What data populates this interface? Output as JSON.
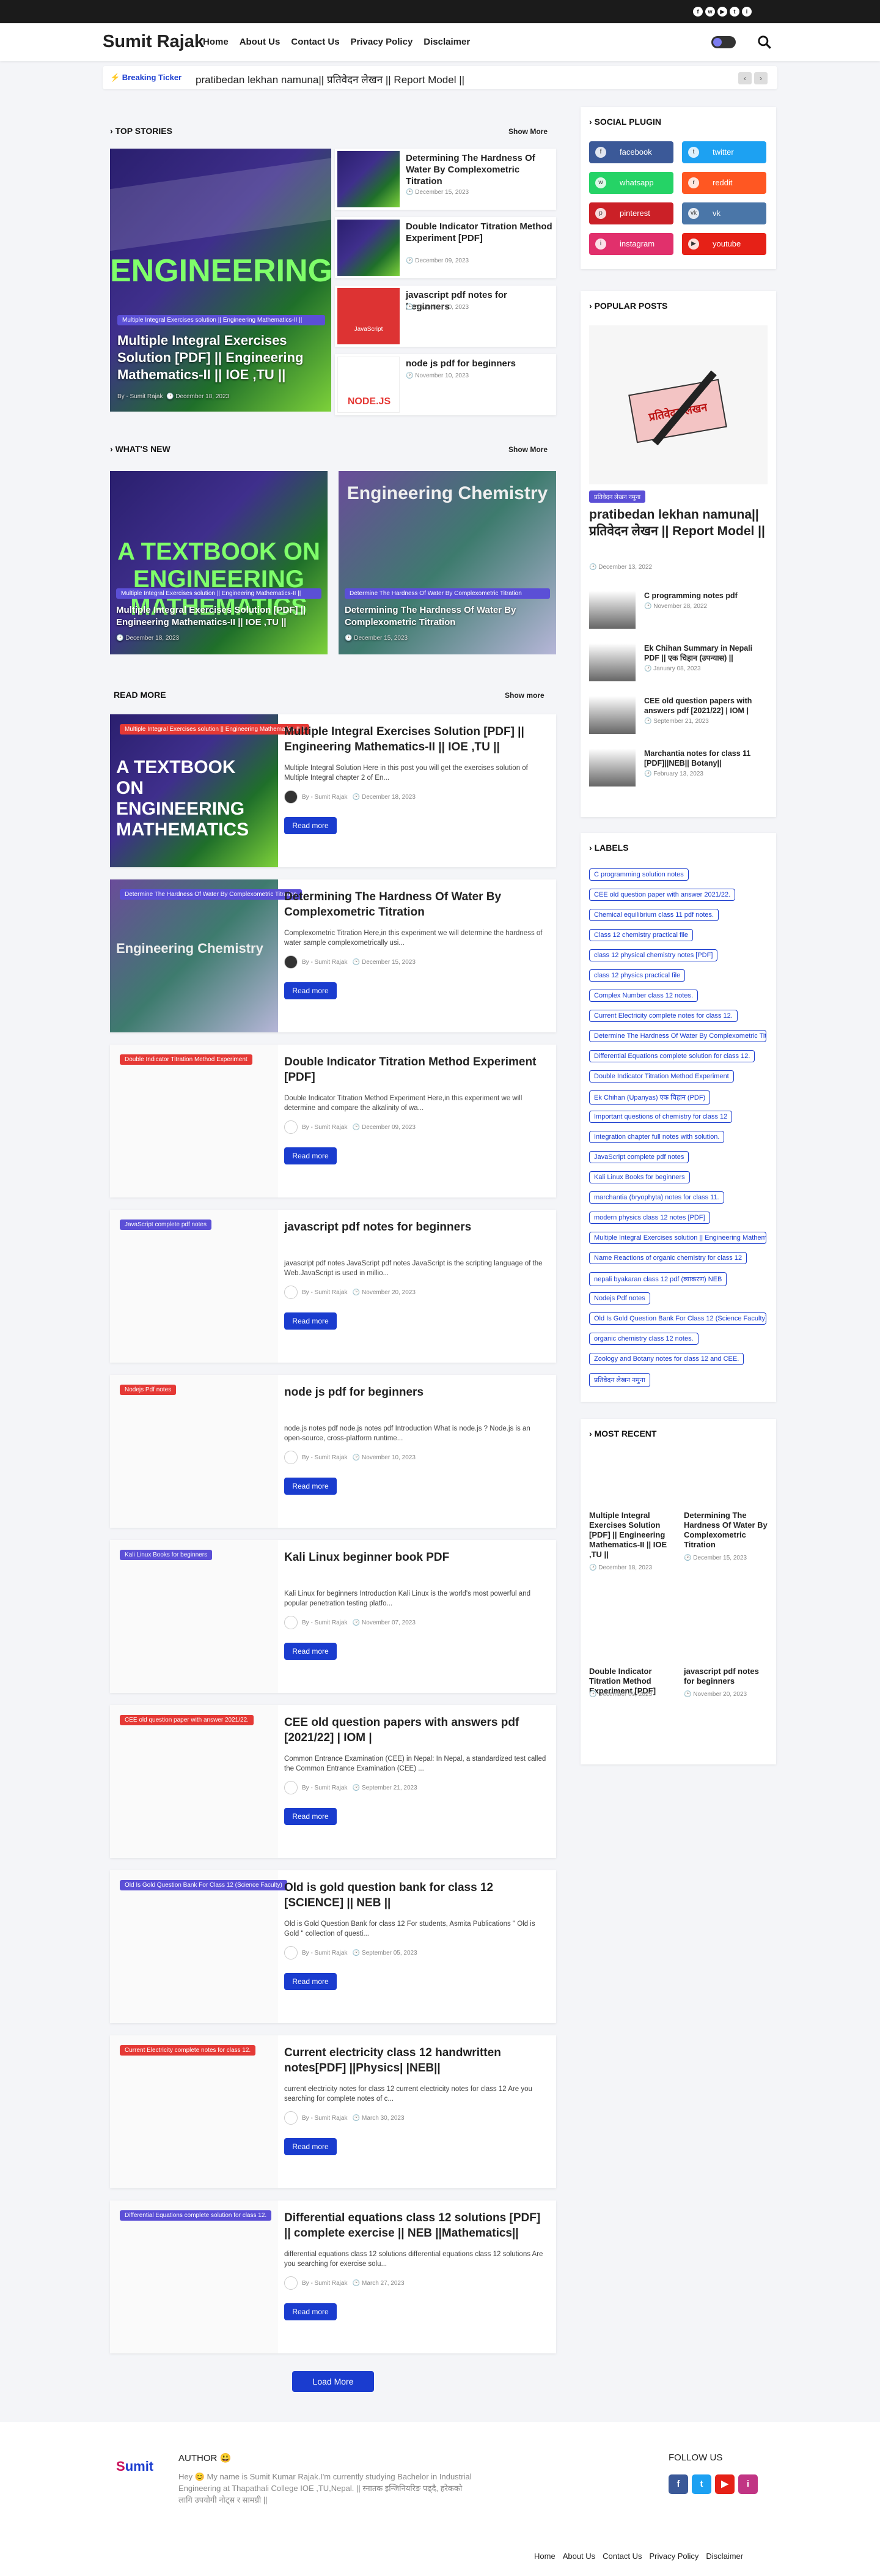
{
  "topbar": {
    "icons": [
      "facebook-icon",
      "whatsapp-icon",
      "youtube-icon",
      "twitter-icon",
      "instagram-icon"
    ]
  },
  "header": {
    "logo": "Sumit Rajak",
    "nav": [
      "Home",
      "About Us",
      "Contact Us",
      "Privacy Policy",
      "Disclaimer"
    ]
  },
  "ticker": {
    "label": "⚡ Breaking Ticker",
    "text": "pratibedan lekhan namuna|| प्रतिवेदन लेखन || Report Model ||"
  },
  "top_stories": {
    "title": "TOP STORIES",
    "show_more": "Show More",
    "feature": {
      "tag": "Multiple Integral Exercises solution || Engineering Mathematics-II ||",
      "title": "Multiple Integral Exercises Solution [PDF] || Engineering Mathematics-II || IOE ,TU ||",
      "author": "By - Sumit Rajak",
      "date": "December 18, 2023"
    },
    "items": [
      {
        "title": "Determining The Hardness Of Water By Complexometric Titration",
        "date": "December 15, 2023"
      },
      {
        "title": "Double Indicator Titration Method Experiment [PDF]",
        "date": "December 09, 2023"
      },
      {
        "title": "javascript pdf notes for beginners",
        "date": "November 20, 2023"
      },
      {
        "title": "node js pdf for beginners",
        "date": "November 10, 2023"
      }
    ]
  },
  "whats_new": {
    "title": "WHAT'S NEW",
    "show_more": "Show More",
    "items": [
      {
        "tag": "Multiple Integral Exercises solution || Engineering Mathematics-II ||",
        "title": "Multiple Integral Exercises Solution [PDF] || Engineering Mathematics-II || IOE ,TU ||",
        "date": "December 18, 2023"
      },
      {
        "tag": "Determine The Hardness Of Water By Complexometric Titration",
        "title": "Determining The Hardness Of Water By Complexometric Titration",
        "date": "December 15, 2023"
      }
    ]
  },
  "read_more": {
    "title": "READ MORE",
    "show_more": "Show more",
    "button": "Read more",
    "author": "By - Sumit Rajak",
    "posts": [
      {
        "tag": "Multiple Integral Exercises solution || Engineering Mathematics-II ||",
        "tag_color": "#e53935",
        "thumb": "math",
        "title": "Multiple Integral Exercises Solution [PDF] || Engineering Mathematics-II || IOE ,TU ||",
        "excerpt": "Multiple Integral Solution  Here in this post you will get the exercises solution of Multiple Integral chapter 2 of En...",
        "date": "December 18, 2023"
      },
      {
        "tag": "Determine The Hardness Of Water By Complexometric Titration",
        "tag_color": "#5b4fd6",
        "thumb": "chem",
        "title": "Determining The Hardness Of Water By Complexometric Titration",
        "excerpt": "Complexometric Titration  Here,in this experiment we will determine the hardness of water sample complexometrically usi...",
        "date": "December 15, 2023"
      },
      {
        "tag": "Double Indicator Titration Method Experiment",
        "tag_color": "#e53935",
        "thumb": "blank",
        "title": "Double Indicator Titration Method Experiment [PDF]",
        "excerpt": "Double Indicator Titration Method Experiment Here,in this experiment we will determine and compare the alkalinity of wa...",
        "date": "December 09, 2023"
      },
      {
        "tag": "JavaScript complete pdf notes",
        "tag_color": "#5b4fd6",
        "thumb": "blank",
        "title": "javascript pdf notes for beginners",
        "excerpt": "javascript pdf notes JavaScript pdf notes  JavaScript is the scripting language of the Web.JavaScript is used in millio...",
        "date": "November 20, 2023"
      },
      {
        "tag": "Nodejs Pdf notes",
        "tag_color": "#e53935",
        "thumb": "blank",
        "title": "node js pdf for beginners",
        "excerpt": "node.js notes pdf node.js notes pdf Introduction   What is node.js ? Node.js is an open-source, cross-platform runtime...",
        "date": "November 10, 2023"
      },
      {
        "tag": "Kali Linux Books for beginners",
        "tag_color": "#5b4fd6",
        "thumb": "blank",
        "title": "Kali Linux beginner book PDF",
        "excerpt": "Kali Linux for beginners  Introduction   Kali Linux is the world's most powerful and popular penetration testing platfo...",
        "date": "November 07, 2023"
      },
      {
        "tag": "CEE old question paper with answer 2021/22.",
        "tag_color": "#e53935",
        "thumb": "blank",
        "title": "CEE old question papers with answers pdf [2021/22] | IOM |",
        "excerpt": "Common Entrance Examination (CEE) in Nepal:  In Nepal, a standardized test called the Common Entrance Examination (CEE) ...",
        "date": "September 21, 2023"
      },
      {
        "tag": "Old Is Gold Question Bank For Class 12 (Science Faculty)",
        "tag_color": "#5b4fd6",
        "thumb": "blank",
        "title": "Old is gold question bank for class 12 [SCIENCE] || NEB ||",
        "excerpt": "Old is Gold Question Bank for class 12 For students, Asmita Publications \" Old is Gold \" collection of questi...",
        "date": "September 05, 2023"
      },
      {
        "tag": "Current Electricity complete notes for class 12.",
        "tag_color": "#e53935",
        "thumb": "blank",
        "title": "Current electricity class 12 handwritten notes[PDF] ||Physics| |NEB||",
        "excerpt": "current electricity notes for class 12 current electricity notes for class 12 Are you searching for complete notes of c...",
        "date": "March 30, 2023"
      },
      {
        "tag": "Differential Equations complete solution for class 12.",
        "tag_color": "#5b4fd6",
        "thumb": "blank",
        "title": "Differential equations class 12 solutions [PDF] || complete exercise || NEB ||Mathematics||",
        "excerpt": "differential equations class 12 solutions differential equations class 12 solutions Are you searching for exercise solu...",
        "date": "March 27, 2023"
      }
    ],
    "load_more": "Load More"
  },
  "sidebar": {
    "social": {
      "title": "SOCIAL PLUGIN",
      "buttons": [
        {
          "label": "facebook",
          "color": "#3b5998",
          "icon": "facebook-icon",
          "glyph": "f"
        },
        {
          "label": "twitter",
          "color": "#1da1f2",
          "icon": "twitter-icon",
          "glyph": "t"
        },
        {
          "label": "whatsapp",
          "color": "#25d366",
          "icon": "whatsapp-icon",
          "glyph": "w"
        },
        {
          "label": "reddit",
          "color": "#ff5722",
          "icon": "reddit-icon",
          "glyph": "r"
        },
        {
          "label": "pinterest",
          "color": "#cb2027",
          "icon": "pinterest-icon",
          "glyph": "p"
        },
        {
          "label": "vk",
          "color": "#4a76a8",
          "icon": "vk-icon",
          "glyph": "vk"
        },
        {
          "label": "instagram",
          "color": "#e1306c",
          "icon": "instagram-icon",
          "glyph": "i"
        },
        {
          "label": "youtube",
          "color": "#e62117",
          "icon": "youtube-icon",
          "glyph": "▶"
        }
      ]
    },
    "popular": {
      "title": "POPULAR POSTS",
      "main_tag": "प्रतिवेदन लेखन नमुना",
      "main_title": "pratibedan lekhan namuna|| प्रतिवेदन लेखन || Report Model ||",
      "main_date": "December 13, 2022",
      "main_art": "प्रतिवेदन लेखन",
      "items": [
        {
          "title": "C programming notes pdf",
          "date": "November 28, 2022"
        },
        {
          "title": "Ek Chihan Summary in Nepali PDF || एक चिहान (उपन्यास) ||",
          "date": "January 08, 2023"
        },
        {
          "title": "CEE old question papers with answers pdf [2021/22] | IOM |",
          "date": "September 21, 2023"
        },
        {
          "title": "Marchantia notes for class 11 [PDF]||NEB|| Botany||",
          "date": "February 13, 2023"
        }
      ]
    },
    "labels": {
      "title": "LABELS",
      "items": [
        "C programming solution notes",
        "CEE old question paper with answer 2021/22.",
        "Chemical equilibrium class 11 pdf notes.",
        "Class 12 chemistry practical file",
        "class 12 physical chemistry notes [PDF]",
        "class 12 physics practical file",
        "Complex Number class 12 notes.",
        "Current Electricity complete notes for class 12.",
        "Determine The Hardness Of Water By Complexometric Titration",
        "Differential Equations complete solution for class 12.",
        "Double Indicator Titration Method Experiment",
        "Ek Chihan (Upanyas) एक चिहान (PDF)",
        "Important questions of chemistry for class 12",
        "Integration chapter full notes with solution.",
        "JavaScript complete pdf notes",
        "Kali Linux Books for beginners",
        "marchantia (bryophyta) notes for class 11.",
        "modern physics class 12 notes [PDF]",
        "Multiple Integral Exercises solution || Engineering Mathematics-II ||",
        "Name Reactions of organic chemistry for class 12",
        "nepali byakaran class 12 pdf (व्याकरण) NEB",
        "Nodejs Pdf notes",
        "Old Is Gold Question Bank For Class 12 (Science Faculty)",
        "organic chemistry class 12 notes.",
        "Zoology and Botany notes for class 12 and CEE.",
        "प्रतिवेदन लेखन नमुना"
      ]
    },
    "recent": {
      "title": "MOST RECENT",
      "items": [
        {
          "title": "Multiple Integral Exercises Solution [PDF] || Engineering Mathematics-II || IOE ,TU ||",
          "date": "December 18, 2023"
        },
        {
          "title": "Determining The Hardness Of Water By Complexometric Titration",
          "date": "December 15, 2023"
        },
        {
          "title": "Double Indicator Titration Method Experiment [PDF]",
          "date": "December 09, 2023"
        },
        {
          "title": "javascript pdf notes for beginners",
          "date": "November 20, 2023"
        }
      ]
    }
  },
  "footer": {
    "author_title": "AUTHOR 😃",
    "author_text": "Hey 😊 My name is Sumit Kumar Rajak.I'm currently studying Bachelor in Industrial Engineering at Thapathali College IOE ,TU,Nepal. || स्नातक इन्जिनियरिङ पढ्दै, हरेकको लागि उपयोगी नोट्स र सामग्री ||",
    "follow_title": "FOLLOW US",
    "nav": [
      "Home",
      "About Us",
      "Contact Us",
      "Privacy Policy",
      "Disclaimer"
    ],
    "follow": [
      {
        "icon": "facebook-icon",
        "glyph": "f",
        "color": "#3b5998"
      },
      {
        "icon": "twitter-icon",
        "glyph": "t",
        "color": "#1da1f2"
      },
      {
        "icon": "youtube-icon",
        "glyph": "▶",
        "color": "#e62117"
      },
      {
        "icon": "instagram-icon",
        "glyph": "i",
        "color": "#c13584"
      }
    ]
  },
  "thumb_text": {
    "math_book": "A TEXTBOOK ON ENGINEERING MATHEMATICS",
    "chem_book": "Engineering Chemistry",
    "java": "JavaScript",
    "node": "NODE.JS"
  }
}
